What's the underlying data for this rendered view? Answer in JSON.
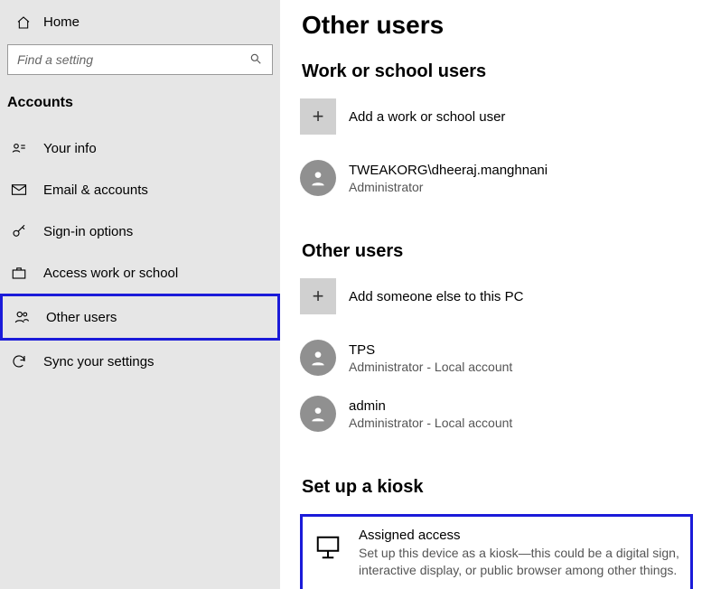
{
  "sidebar": {
    "home_label": "Home",
    "search_placeholder": "Find a setting",
    "section_title": "Accounts",
    "items": [
      {
        "label": "Your info"
      },
      {
        "label": "Email & accounts"
      },
      {
        "label": "Sign-in options"
      },
      {
        "label": "Access work or school"
      },
      {
        "label": "Other users"
      },
      {
        "label": "Sync your settings"
      }
    ]
  },
  "main": {
    "page_title": "Other users",
    "work_school": {
      "heading": "Work or school users",
      "add_label": "Add a work or school user",
      "users": [
        {
          "name": "TWEAKORG\\dheeraj.manghnani",
          "role": "Administrator"
        }
      ]
    },
    "other_users": {
      "heading": "Other users",
      "add_label": "Add someone else to this PC",
      "users": [
        {
          "name": "TPS",
          "role": "Administrator - Local account"
        },
        {
          "name": "admin",
          "role": "Administrator - Local account"
        }
      ]
    },
    "kiosk": {
      "heading": "Set up a kiosk",
      "title": "Assigned access",
      "description": "Set up this device as a kiosk—this could be a digital sign, interactive display, or public browser among other things."
    }
  },
  "highlight_color": "#1b1bd9"
}
